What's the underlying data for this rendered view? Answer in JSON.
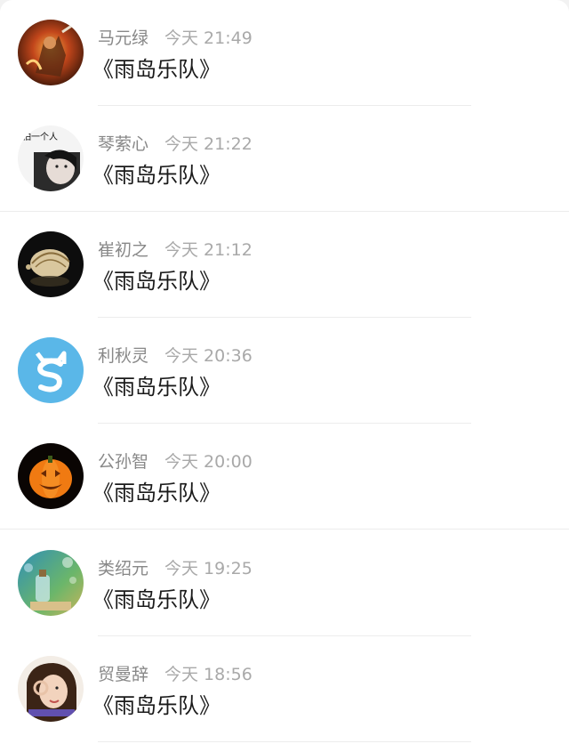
{
  "comments": [
    {
      "name": "马元绿",
      "time": "今天 21:49",
      "text": "《雨岛乐队》",
      "avatar": "warrior-fire-avatar"
    },
    {
      "name": "琴萦心",
      "time": "今天 21:22",
      "text": "《雨岛乐队》",
      "avatar": "girl-photo-avatar",
      "avatar_caption": "怕一个人"
    },
    {
      "name": "崔初之",
      "time": "今天 21:12",
      "text": "《雨岛乐队》",
      "avatar": "seashell-avatar"
    },
    {
      "name": "利秋灵",
      "time": "今天 20:36",
      "text": "《雨岛乐队》",
      "avatar": "cat-s-logo-avatar"
    },
    {
      "name": "公孙智",
      "time": "今天 20:00",
      "text": "《雨岛乐队》",
      "avatar": "pumpkin-avatar"
    },
    {
      "name": "类绍元",
      "time": "今天 19:25",
      "text": "《雨岛乐队》",
      "avatar": "bottle-bokeh-avatar"
    },
    {
      "name": "贸曼辞",
      "time": "今天 18:56",
      "text": "《雨岛乐队》",
      "avatar": "girl-ok-hand-avatar"
    }
  ],
  "colors": {
    "name": "#888888",
    "time": "#a9a9a9",
    "text": "#1a1a1a",
    "divider": "#ececec"
  }
}
